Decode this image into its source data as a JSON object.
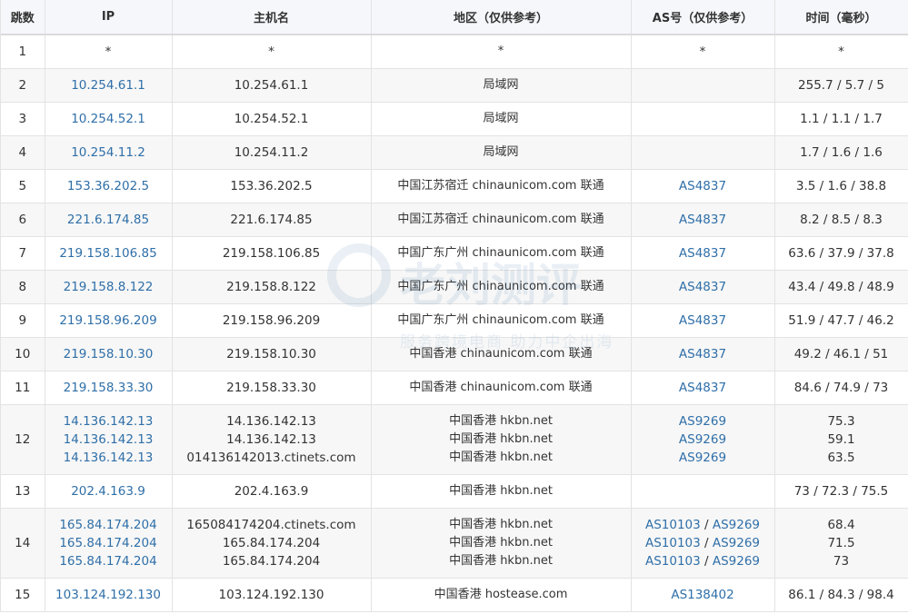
{
  "headers": {
    "hop": "跳数",
    "ip": "IP",
    "hostname": "主机名",
    "region": "地区（仅供参考）",
    "as": "AS号（仅供参考）",
    "time": "时间（毫秒）"
  },
  "rows": [
    {
      "hop": "1",
      "lines": [
        {
          "ip": "*",
          "host": "*",
          "region": "*",
          "as": "*",
          "time": "*"
        }
      ]
    },
    {
      "hop": "2",
      "lines": [
        {
          "ip": "10.254.61.1",
          "host": "10.254.61.1",
          "region": "局域网",
          "as": "",
          "time": "255.7 / 5.7 / 5"
        }
      ]
    },
    {
      "hop": "3",
      "lines": [
        {
          "ip": "10.254.52.1",
          "host": "10.254.52.1",
          "region": "局域网",
          "as": "",
          "time": "1.1 / 1.1 / 1.7"
        }
      ]
    },
    {
      "hop": "4",
      "lines": [
        {
          "ip": "10.254.11.2",
          "host": "10.254.11.2",
          "region": "局域网",
          "as": "",
          "time": "1.7 / 1.6 / 1.6"
        }
      ]
    },
    {
      "hop": "5",
      "lines": [
        {
          "ip": "153.36.202.5",
          "host": "153.36.202.5",
          "region": "中国江苏宿迁 chinaunicom.com 联通",
          "as": "AS4837",
          "time": "3.5 / 1.6 / 38.8"
        }
      ]
    },
    {
      "hop": "6",
      "lines": [
        {
          "ip": "221.6.174.85",
          "host": "221.6.174.85",
          "region": "中国江苏宿迁 chinaunicom.com 联通",
          "as": "AS4837",
          "time": "8.2 / 8.5 / 8.3"
        }
      ]
    },
    {
      "hop": "7",
      "lines": [
        {
          "ip": "219.158.106.85",
          "host": "219.158.106.85",
          "region": "中国广东广州 chinaunicom.com 联通",
          "as": "AS4837",
          "time": "63.6 / 37.9 / 37.8"
        }
      ]
    },
    {
      "hop": "8",
      "lines": [
        {
          "ip": "219.158.8.122",
          "host": "219.158.8.122",
          "region": "中国广东广州 chinaunicom.com 联通",
          "as": "AS4837",
          "time": "43.4 / 49.8 / 48.9"
        }
      ]
    },
    {
      "hop": "9",
      "lines": [
        {
          "ip": "219.158.96.209",
          "host": "219.158.96.209",
          "region": "中国广东广州 chinaunicom.com 联通",
          "as": "AS4837",
          "time": "51.9 / 47.7 / 46.2"
        }
      ]
    },
    {
      "hop": "10",
      "lines": [
        {
          "ip": "219.158.10.30",
          "host": "219.158.10.30",
          "region": "中国香港 chinaunicom.com 联通",
          "as": "AS4837",
          "time": "49.2 / 46.1 / 51"
        }
      ]
    },
    {
      "hop": "11",
      "lines": [
        {
          "ip": "219.158.33.30",
          "host": "219.158.33.30",
          "region": "中国香港 chinaunicom.com 联通",
          "as": "AS4837",
          "time": "84.6 / 74.9 / 73"
        }
      ]
    },
    {
      "hop": "12",
      "lines": [
        {
          "ip": "14.136.142.13",
          "host": "14.136.142.13",
          "region": "中国香港 hkbn.net",
          "as": "AS9269",
          "time": "75.3"
        },
        {
          "ip": "14.136.142.13",
          "host": "14.136.142.13",
          "region": "中国香港 hkbn.net",
          "as": "AS9269",
          "time": "59.1"
        },
        {
          "ip": "14.136.142.13",
          "host": "014136142013.ctinets.com",
          "region": "中国香港 hkbn.net",
          "as": "AS9269",
          "time": "63.5"
        }
      ]
    },
    {
      "hop": "13",
      "lines": [
        {
          "ip": "202.4.163.9",
          "host": "202.4.163.9",
          "region": "中国香港 hkbn.net",
          "as": "",
          "time": "73 / 72.3 / 75.5"
        }
      ]
    },
    {
      "hop": "14",
      "lines": [
        {
          "ip": "165.84.174.204",
          "host": "165084174204.ctinets.com",
          "region": "中国香港 hkbn.net",
          "as": "AS10103",
          "as2": "AS9269",
          "time": "68.4"
        },
        {
          "ip": "165.84.174.204",
          "host": "165.84.174.204",
          "region": "中国香港 hkbn.net",
          "as": "AS10103",
          "as2": "AS9269",
          "time": "71.5"
        },
        {
          "ip": "165.84.174.204",
          "host": "165.84.174.204",
          "region": "中国香港 hkbn.net",
          "as": "AS10103",
          "as2": "AS9269",
          "time": "73"
        }
      ]
    },
    {
      "hop": "15",
      "lines": [
        {
          "ip": "103.124.192.130",
          "host": "103.124.192.130",
          "region": "中国香港 hostease.com",
          "as": "AS138402",
          "time": "86.1 / 84.3 / 98.4"
        }
      ]
    }
  ],
  "as_separator": " / ",
  "watermark": {
    "title": "老刘测评",
    "subtitle": "服务跨境电商 助力中企出海"
  },
  "colors": {
    "link": "#2f6fa8",
    "header_bg": "#f6f7fb",
    "stripe": "#f7f7f7",
    "border": "#e3e3e3"
  }
}
